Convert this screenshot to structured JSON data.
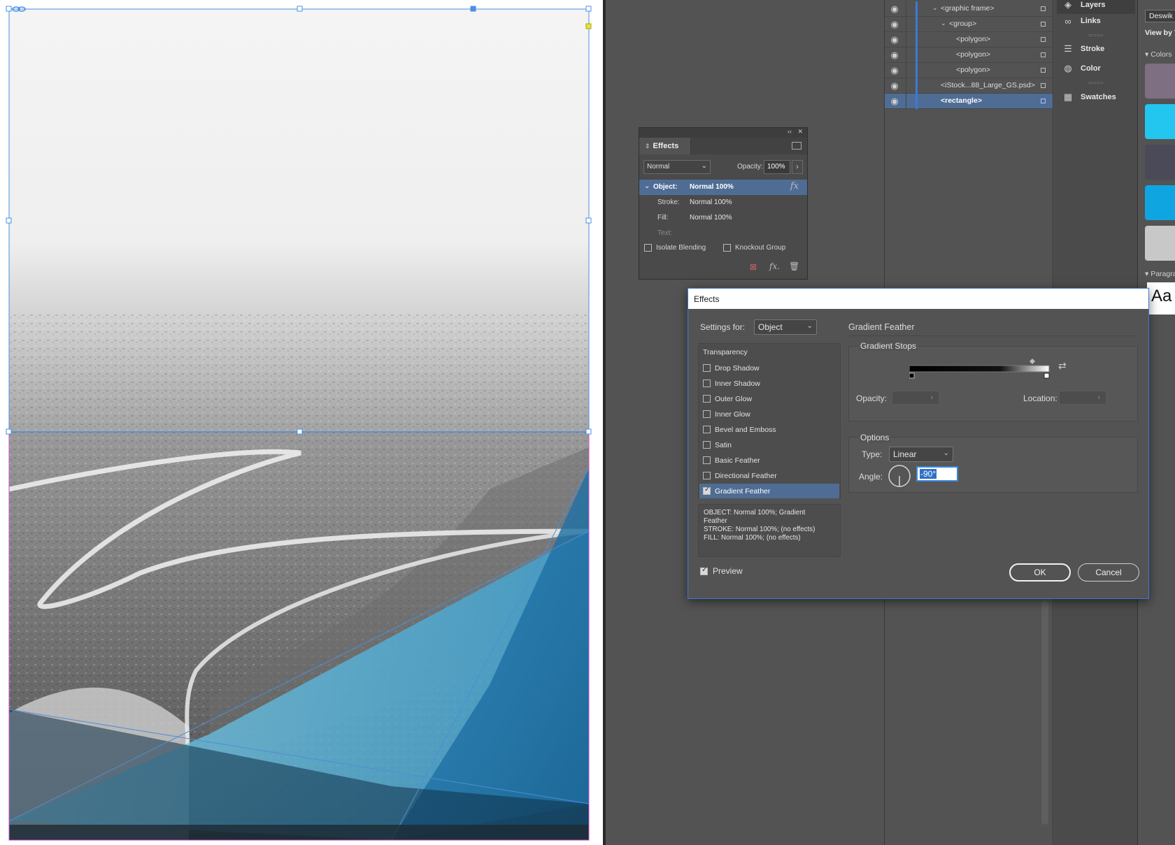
{
  "layers": {
    "rows": [
      {
        "name": "<graphic frame>",
        "selected": false
      },
      {
        "name": "<group>",
        "selected": false
      },
      {
        "name": "<polygon>",
        "selected": false
      },
      {
        "name": "<polygon>",
        "selected": false
      },
      {
        "name": "<polygon>",
        "selected": false
      },
      {
        "name": "<iStock...88_Large_GS.psd>",
        "selected": false
      },
      {
        "name": "<rectangle>",
        "selected": true
      }
    ]
  },
  "dock": {
    "items": [
      {
        "label": "Layers",
        "icon": "layers-icon"
      },
      {
        "label": "Links",
        "icon": "links-icon"
      },
      {
        "label": "Stroke",
        "icon": "stroke-icon"
      },
      {
        "label": "Color",
        "icon": "color-icon"
      },
      {
        "label": "Swatches",
        "icon": "swatches-icon"
      }
    ]
  },
  "side_panel": {
    "workspace_btn": "Deswik",
    "view_by": "View by T",
    "colors_header": "Colors",
    "paragraph_header": "Paragra",
    "aa_sample": "Aa",
    "swatch_colors": [
      "#7f6f82",
      "#22c6ef",
      "#4a4a59",
      "#0fa5e0",
      "#c8c8c8"
    ]
  },
  "effects_panel": {
    "tab_label": "Effects",
    "blend_mode": "Normal",
    "opacity_label": "Opacity:",
    "opacity_value": "100%",
    "rows": [
      {
        "key": "Object:",
        "value": "Normal 100%"
      },
      {
        "key": "Stroke:",
        "value": "Normal 100%"
      },
      {
        "key": "Fill:",
        "value": "Normal 100%"
      },
      {
        "key": "Text:",
        "value": ""
      }
    ],
    "isolate_blending": "Isolate Blending",
    "knockout_group": "Knockout Group"
  },
  "dialog": {
    "title": "Effects",
    "settings_for_label": "Settings for:",
    "settings_for_value": "Object",
    "effect_list_header": "Transparency",
    "effects": [
      {
        "label": "Drop Shadow",
        "checked": false
      },
      {
        "label": "Inner Shadow",
        "checked": false
      },
      {
        "label": "Outer Glow",
        "checked": false
      },
      {
        "label": "Inner Glow",
        "checked": false
      },
      {
        "label": "Bevel and Emboss",
        "checked": false
      },
      {
        "label": "Satin",
        "checked": false
      },
      {
        "label": "Basic Feather",
        "checked": false
      },
      {
        "label": "Directional Feather",
        "checked": false
      },
      {
        "label": "Gradient Feather",
        "checked": true
      }
    ],
    "summary_lines": [
      "OBJECT: Normal 100%; Gradient",
      "Feather",
      "STROKE: Normal 100%; (no effects)",
      "FILL: Normal 100%; (no effects)"
    ],
    "section_title": "Gradient Feather",
    "gradient_stops_title": "Gradient Stops",
    "opacity_label": "Opacity:",
    "location_label": "Location:",
    "options_title": "Options",
    "type_label": "Type:",
    "type_value": "Linear",
    "angle_label": "Angle:",
    "angle_value": "-90°",
    "preview_label": "Preview",
    "preview_checked": true,
    "ok_label": "OK",
    "cancel_label": "Cancel"
  }
}
